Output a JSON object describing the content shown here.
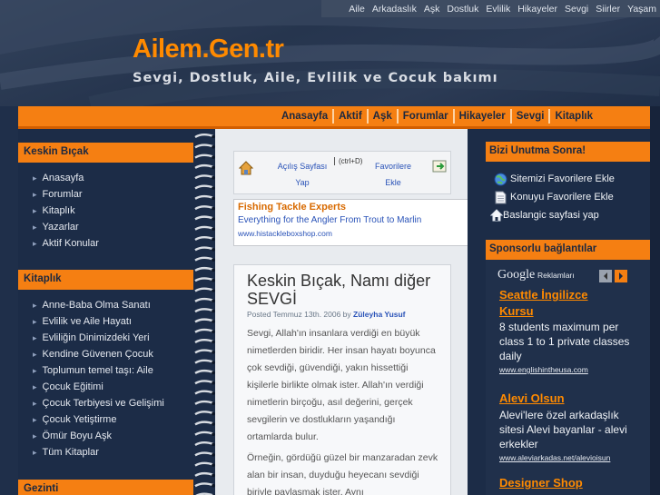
{
  "site": {
    "title": "Ailem.Gen.tr",
    "tagline": "Sevgi, Dostluk, Aile, Evlilik ve Cocuk bakımı",
    "accent": "#f57f12",
    "background": "#1c2c47"
  },
  "top_links": [
    "Aile",
    "Arkadaslık",
    "Aşk",
    "Dostluk",
    "Evlilik",
    "Hikayeler",
    "Sevgi",
    "Siirler",
    "Yaşam"
  ],
  "main_nav": [
    "Anasayfa",
    "Aktif",
    "Aşk",
    "Forumlar",
    "Hikayeler",
    "Sevgi",
    "Kitaplık"
  ],
  "left_sidebar": {
    "section1": {
      "title": "Keskin Bıçak",
      "items": [
        "Anasayfa",
        "Forumlar",
        "Kitaplık",
        "Yazarlar",
        "Aktif Konular"
      ]
    },
    "section2": {
      "title": "Kitaplık",
      "items": [
        "Anne-Baba Olma Sanatı",
        "Evlilik ve Aile Hayatı",
        "Evliliğin Dinimizdeki Yeri",
        "Kendine Güvenen Çocuk",
        "Toplumun temel taşı: Aile",
        "Çocuk Eğitimi",
        "Çocuk Terbiyesi ve Gelişimi",
        "Çocuk Yetiştirme",
        "Ömür Boyu Aşk",
        "Tüm Kitaplar"
      ]
    },
    "section3": {
      "title": "Gezinti"
    }
  },
  "toolbar": {
    "homepage_link_line1": "Açılış Sayfası",
    "homepage_link_line2": "Yap",
    "shortcut": "(ctrl+D)",
    "favorites_link_line1": "Favorilere",
    "favorites_link_line2": "Ekle"
  },
  "text_ad": {
    "title": "Fishing Tackle Experts",
    "text": "Everything for the Angler From Trout to Marlin",
    "url": "www.histackleboxshop.com"
  },
  "post": {
    "title_line1": "Keskin Bıçak, Namı diğer",
    "title_line2": "SEVGİ",
    "meta_prefix": "Posted Temmuz 13th. 2006 by",
    "author": "Züleyha Yusuf",
    "para1": "Sevgi, Allah'ın insanlara verdiği en büyük nimetlerden biridir. Her insan hayatı boyunca çok sevdiği, güvendiği, yakın hissettiği kişilerle birlikte olmak ister. Allah'ın verdiği nimetlerin birçoğu, asıl değerini, gerçek sevgilerin ve dostlukların yaşandığı ortamlarda bulur.",
    "para2": "Örneğin, gördüğü güzel bir manzaradan zevk alan bir insan, duyduğu heyecanı sevdiği biriyle paylaşmak ister. Aynı"
  },
  "right_sidebar": {
    "section1": {
      "title": "Bizi Unutma Sonra!",
      "links": [
        "Sitemizi Favorilere Ekle",
        "Konuyu Favorilere Ekle",
        "Baslangic sayfasi yap"
      ]
    },
    "section2": {
      "title": "Sponsorlu bağlantılar",
      "google_label": "Google",
      "google_suffix": "Reklamları",
      "ads": [
        {
          "title_line1": "Seattle İngilizce",
          "title_line2": "Kursu",
          "text": "8 students maximum per class 1 to 1 private classes daily",
          "url": "www.englishintheusa.com"
        },
        {
          "title_line1": "Alevi Olsun",
          "text": "Alevi'lere özel arkadaşlık sitesi Alevi bayanlar - alevi erkekler",
          "url": "www.aleviarkadas.net/alevioisun"
        },
        {
          "title_line1": "Designer Shop"
        }
      ]
    }
  }
}
